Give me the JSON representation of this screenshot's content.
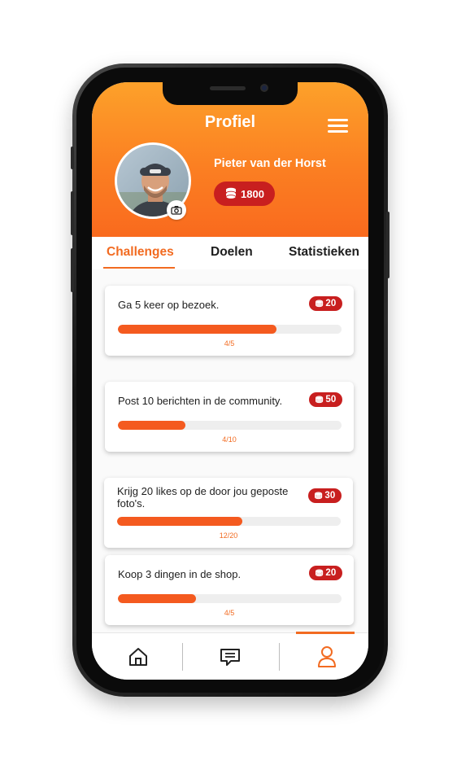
{
  "header": {
    "title": "Profiel",
    "user_name": "Pieter van der Horst",
    "coins": "1800",
    "colors": {
      "gradient_top": "#fda12a",
      "gradient_bottom": "#f96a1e",
      "coin_badge": "#c81f1f"
    }
  },
  "tabs": [
    {
      "label": "Challenges",
      "active": true
    },
    {
      "label": "Doelen",
      "active": false
    },
    {
      "label": "Statistieken",
      "active": false
    }
  ],
  "challenges": [
    {
      "text": "Ga 5 keer op bezoek.",
      "reward": "20",
      "progress_label": "4/5",
      "progress": 0.71
    },
    {
      "text": "Post 10 berichten in de community.",
      "reward": "50",
      "progress_label": "4/10",
      "progress": 0.3
    },
    {
      "text": "Krijg 20 likes op de door jou geposte foto's.",
      "reward": "30",
      "progress_label": "12/20",
      "progress": 0.56
    },
    {
      "text": "Koop 3 dingen in de shop.",
      "reward": "20",
      "progress_label": "4/5",
      "progress": 0.35
    }
  ],
  "bottom_nav": [
    {
      "icon": "home-icon",
      "active": false
    },
    {
      "icon": "chat-icon",
      "active": false
    },
    {
      "icon": "profile-icon",
      "active": true
    }
  ],
  "accent_color": "#f26b21"
}
